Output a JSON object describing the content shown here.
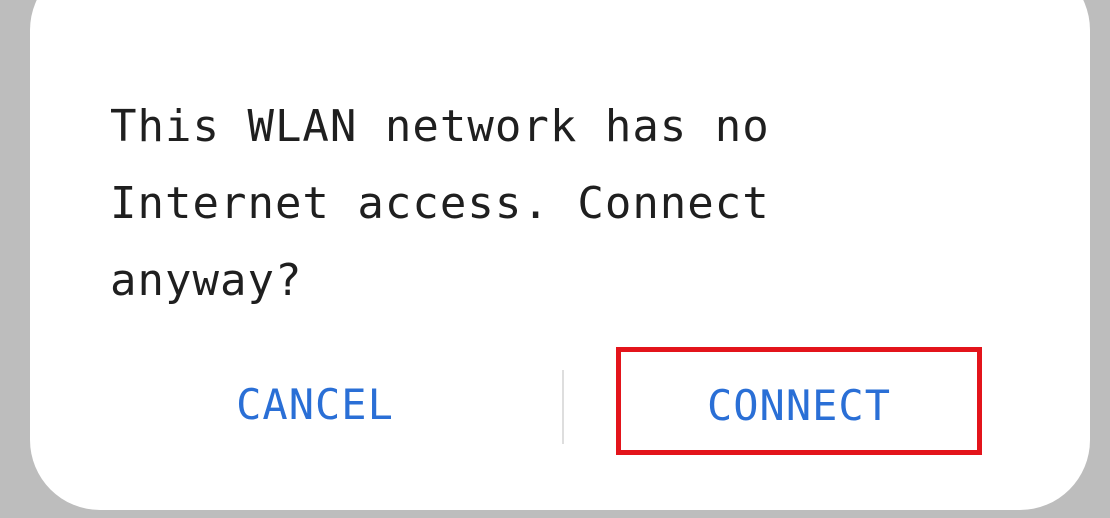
{
  "dialog": {
    "message": "This WLAN network has no Internet access. Connect anyway?",
    "cancel_label": "CANCEL",
    "connect_label": "CONNECT"
  },
  "colors": {
    "background": "#bdbdbd",
    "dialog": "#ffffff",
    "text": "#1f1f1f",
    "button_text": "#2a6fd6",
    "highlight_border": "#e3141b"
  }
}
